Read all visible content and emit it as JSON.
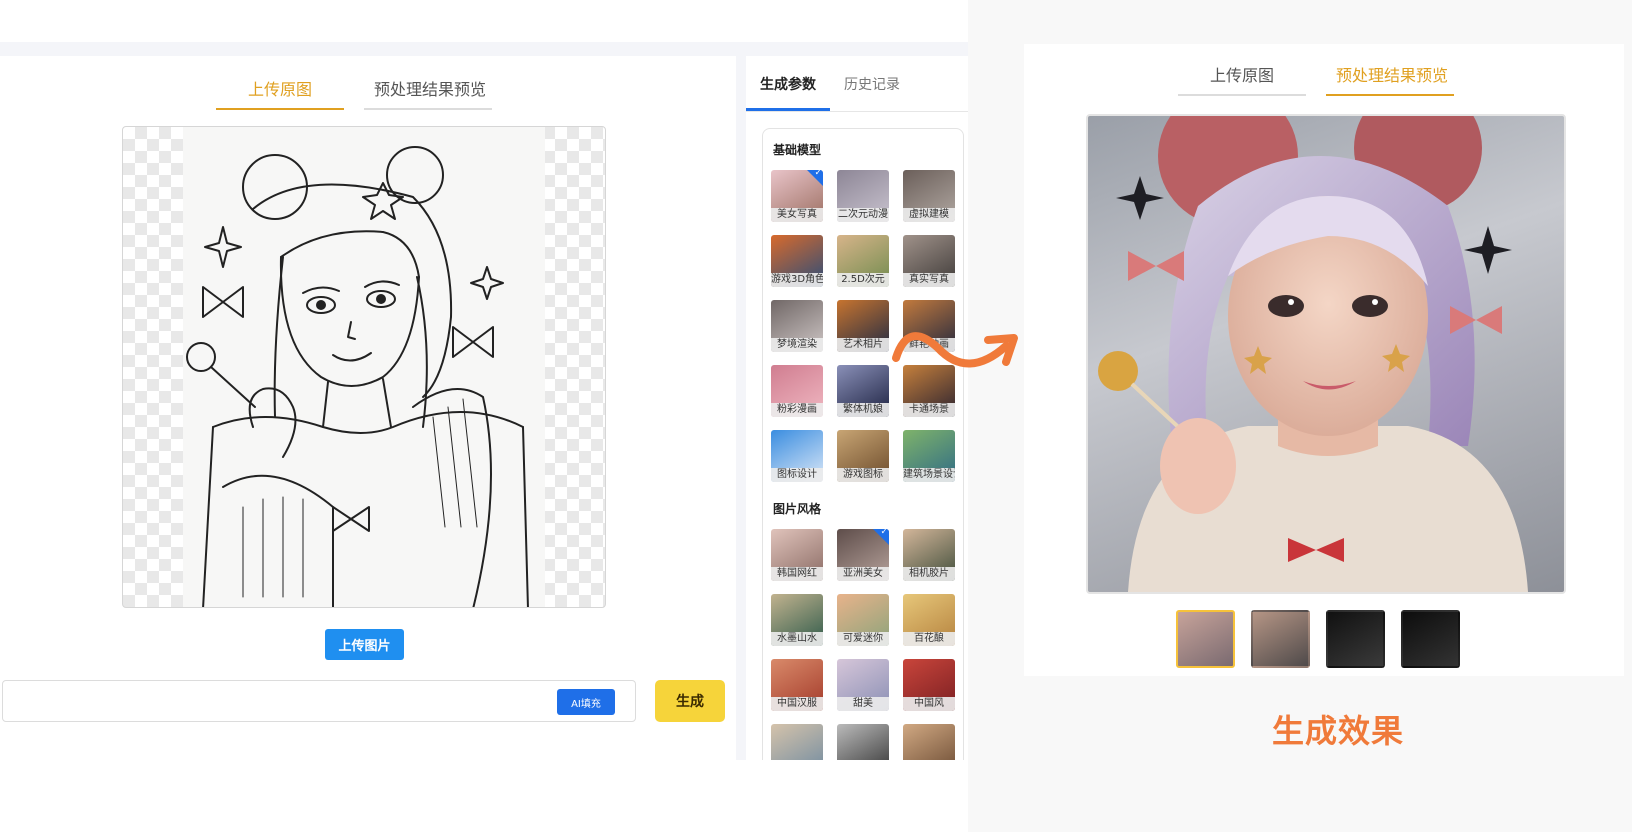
{
  "left_panel": {
    "tabs": [
      {
        "label": "上传原图",
        "active": true
      },
      {
        "label": "预处理结果预览",
        "active": false
      }
    ],
    "upload_button": "上传图片",
    "prompt": {
      "value": "",
      "placeholder": ""
    },
    "ai_fill_button": "AI填充",
    "generate_button": "生成"
  },
  "param_panel": {
    "tabs": [
      {
        "label": "生成参数",
        "active": true
      },
      {
        "label": "历史记录",
        "active": false
      }
    ],
    "sections": [
      {
        "title": "基础模型",
        "items": [
          {
            "label": "美女写真",
            "selected": true,
            "color_a": "#9c6f62",
            "color_b": "#e9c4c9"
          },
          {
            "label": "二次元动漫",
            "selected": false,
            "color_a": "#c9c3cf",
            "color_b": "#8d8696"
          },
          {
            "label": "虚拟建模",
            "selected": false,
            "color_a": "#b1a8a2",
            "color_b": "#6b5f5a"
          },
          {
            "label": "游戏3D角色",
            "selected": false,
            "color_a": "#2a4d7a",
            "color_b": "#d86a2c"
          },
          {
            "label": "2.5D次元",
            "selected": false,
            "color_a": "#6f8b4d",
            "color_b": "#d7b48a"
          },
          {
            "label": "真实写真",
            "selected": false,
            "color_a": "#3e3a38",
            "color_b": "#a0928a"
          },
          {
            "label": "梦境渲染",
            "selected": false,
            "color_a": "#cfc7c6",
            "color_b": "#706766"
          },
          {
            "label": "艺术相片",
            "selected": false,
            "color_a": "#1f2a44",
            "color_b": "#c7742f"
          },
          {
            "label": "鲜艳动画",
            "selected": false,
            "color_a": "#23283f",
            "color_b": "#c27a3d"
          },
          {
            "label": "粉彩漫画",
            "selected": false,
            "color_a": "#f0b8c2",
            "color_b": "#d07d90"
          },
          {
            "label": "繁体机娘",
            "selected": false,
            "color_a": "#1c2140",
            "color_b": "#8a90b8"
          },
          {
            "label": "卡通场景",
            "selected": false,
            "color_a": "#2a2230",
            "color_b": "#c6803c"
          },
          {
            "label": "图标设计",
            "selected": false,
            "color_a": "#dce8f7",
            "color_b": "#3a8de0"
          },
          {
            "label": "游戏图标",
            "selected": false,
            "color_a": "#6b4a2a",
            "color_b": "#c8a574"
          },
          {
            "label": "建筑场景设计",
            "selected": false,
            "color_a": "#2f6b86",
            "color_b": "#7fb36a"
          }
        ]
      },
      {
        "title": "图片风格",
        "items": [
          {
            "label": "韩国网红",
            "selected": false,
            "color_a": "#8a6b64",
            "color_b": "#e0c3bb"
          },
          {
            "label": "亚洲美女",
            "selected": true,
            "color_a": "#b7a39c",
            "color_b": "#5e4d4a"
          },
          {
            "label": "相机胶片",
            "selected": false,
            "color_a": "#3f4d3a",
            "color_b": "#d3b69a"
          },
          {
            "label": "水墨山水",
            "selected": false,
            "color_a": "#2e5a4a",
            "color_b": "#c2b38f"
          },
          {
            "label": "可爱迷你",
            "selected": false,
            "color_a": "#8aa37a",
            "color_b": "#e8b38b"
          },
          {
            "label": "百花酿",
            "selected": false,
            "color_a": "#b5823e",
            "color_b": "#e7c77a"
          },
          {
            "label": "中国汉服",
            "selected": false,
            "color_a": "#a33a2a",
            "color_b": "#d98a6a"
          },
          {
            "label": "甜美",
            "selected": false,
            "color_a": "#8a8fb4",
            "color_b": "#d6c6d9"
          },
          {
            "label": "中国风",
            "selected": false,
            "color_a": "#7a1f22",
            "color_b": "#c9453b"
          },
          {
            "label": "",
            "selected": false,
            "color_a": "#6f8aa0",
            "color_b": "#d5c3ab"
          },
          {
            "label": "",
            "selected": false,
            "color_a": "#333333",
            "color_b": "#bbbbbb"
          },
          {
            "label": "",
            "selected": false,
            "color_a": "#6a4a32",
            "color_b": "#d1a983"
          }
        ]
      }
    ]
  },
  "right_panel": {
    "tabs": [
      {
        "label": "上传原图",
        "active": false
      },
      {
        "label": "预处理结果预览",
        "active": true
      }
    ],
    "thumbnails": [
      {
        "name": "result-1",
        "active": true,
        "color_a": "#c7a39a",
        "color_b": "#7a6a70"
      },
      {
        "name": "result-2",
        "active": false,
        "color_a": "#b59585",
        "color_b": "#4f4a4a"
      },
      {
        "name": "lineart-1",
        "active": false,
        "color_a": "#111111",
        "color_b": "#3a3a3a"
      },
      {
        "name": "lineart-2",
        "active": false,
        "color_a": "#0d0d0d",
        "color_b": "#333333"
      }
    ],
    "effect_label": "生成效果"
  },
  "colors": {
    "accent_tab": "#e0a020",
    "primary_blue": "#1f8ff0",
    "generate_yellow": "#f6d43a",
    "arrow_orange": "#f07a3a",
    "effect_label": "#f07a3a"
  }
}
